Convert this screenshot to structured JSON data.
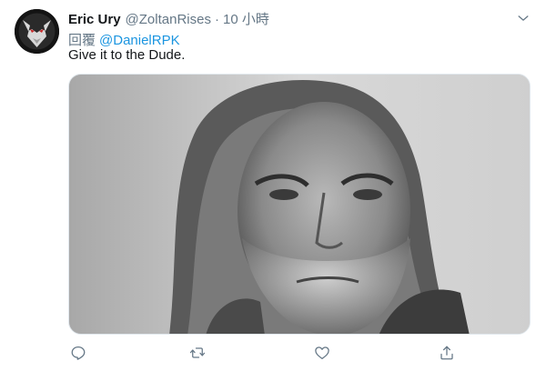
{
  "tweet": {
    "display_name": "Eric Ury",
    "handle": "@ZoltanRises",
    "separator": "·",
    "time": "10 小時",
    "reply_prefix": "回覆",
    "reply_mention": "@DanielRPK",
    "text": "Give it to the Dude."
  },
  "icons": {
    "more": "chevron-down-icon",
    "reply": "reply-icon",
    "retweet": "retweet-icon",
    "like": "heart-icon",
    "share": "share-icon"
  },
  "colors": {
    "accent": "#1b95e0",
    "secondary_text": "#657786",
    "primary_text": "#14171a",
    "icon": "#657786"
  }
}
